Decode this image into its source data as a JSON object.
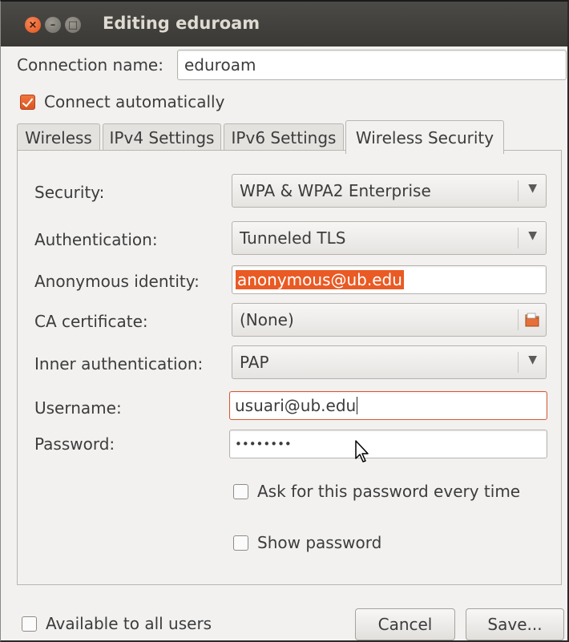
{
  "window": {
    "title": "Editing eduroam",
    "controls": {
      "close": "×",
      "minimize": "–",
      "maximize": "□"
    }
  },
  "connection": {
    "name_label": "Connection name:",
    "name_value": "eduroam",
    "auto_label": "Connect automatically",
    "auto_checked": true
  },
  "tabs": [
    {
      "label": "Wireless",
      "active": false
    },
    {
      "label": "IPv4 Settings",
      "active": false
    },
    {
      "label": "IPv6 Settings",
      "active": false
    },
    {
      "label": "Wireless Security",
      "active": true
    }
  ],
  "security": {
    "security_label": "Security:",
    "security_value": "WPA & WPA2 Enterprise",
    "auth_label": "Authentication:",
    "auth_value": "Tunneled TLS",
    "anon_label": "Anonymous identity:",
    "anon_value": "anonymous@ub.edu",
    "ca_label": "CA certificate:",
    "ca_value": "(None)",
    "inner_label": "Inner authentication:",
    "inner_value": "PAP",
    "username_label": "Username:",
    "username_value": "usuari@ub.edu",
    "password_label": "Password:",
    "password_value": "••••••••",
    "ask_label": "Ask for this password every time",
    "ask_checked": false,
    "show_label": "Show password",
    "show_checked": false
  },
  "footer": {
    "available_label": "Available to all users",
    "available_checked": false,
    "cancel_label": "Cancel",
    "save_label": "Save..."
  },
  "colors": {
    "accent": "#e95a24",
    "titlebar": "#3c3b37"
  },
  "icons": {
    "dropdown": "chevron-down-icon",
    "file": "folder-icon",
    "pointer": "mouse-pointer-icon"
  }
}
